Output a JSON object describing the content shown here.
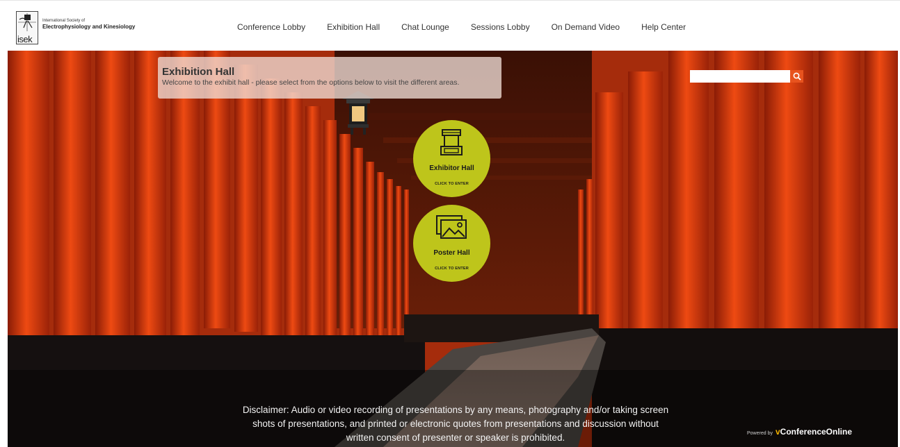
{
  "header": {
    "logo": {
      "abbr": "isek",
      "line1": "International Society of",
      "line2": "Electrophysiology and Kinesiology"
    },
    "nav": [
      "Conference Lobby",
      "Exhibition Hall",
      "Chat Lounge",
      "Sessions Lobby",
      "On Demand Video",
      "Help Center"
    ]
  },
  "hero": {
    "title": "Exhibition Hall",
    "subtitle": "Welcome to the exhibit hall - please select from the options below to visit the different areas.",
    "search": {
      "placeholder": ""
    },
    "buttons": [
      {
        "label": "Exhibitor Hall",
        "sub": "CLICK TO ENTER",
        "icon": "booth-icon"
      },
      {
        "label": "Poster Hall",
        "sub": "CLICK TO ENTER",
        "icon": "picture-icon"
      }
    ],
    "disclaimer": "Disclaimer: Audio or video recording of presentations by any means, photography and/or taking screen shots of presentations, and printed or electronic quotes from presentations and discussion without written consent of presenter or speaker is prohibited.",
    "powered_by": {
      "prefix": "Powered by",
      "brand_mark": "v",
      "brand": "ConferenceOnline"
    }
  },
  "colors": {
    "accent": "#bec51b",
    "search_button": "#e8531e",
    "torii_orange": "#d9400f"
  }
}
